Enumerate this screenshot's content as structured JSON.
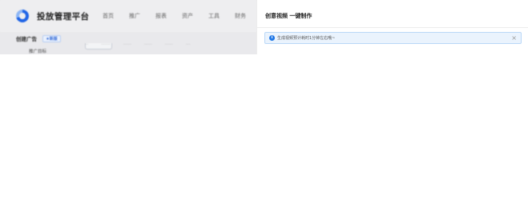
{
  "background_app": {
    "brand": "投放管理平台",
    "nav": [
      "首页",
      "推广",
      "报表",
      "资产",
      "工具",
      "财务"
    ],
    "create_title": "创建广告",
    "create_tag": "★新版",
    "sub_item": "推广目标",
    "tabs": [
      "···",
      "········",
      "·······",
      "·······",
      "·······",
      "····"
    ]
  },
  "drawer": {
    "title": "创意视频 一键制作",
    "alert": {
      "icon": "info-icon",
      "text": "生成视频预计耗时1分钟左右哦~",
      "close": "×"
    }
  },
  "colors": {
    "accent": "#1f77e6",
    "alert_bg": "#eaf3fd",
    "alert_border": "#b9d7f7"
  }
}
